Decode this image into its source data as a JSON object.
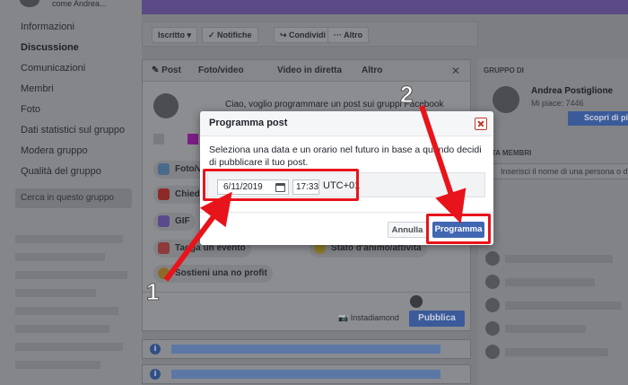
{
  "topbar": {
    "user_text": "come Andrea..."
  },
  "leftnav": {
    "items": [
      {
        "label": "Informazioni",
        "active": false
      },
      {
        "label": "Discussione",
        "active": true
      },
      {
        "label": "Comunicazioni",
        "active": false
      },
      {
        "label": "Membri",
        "active": false
      },
      {
        "label": "Foto",
        "active": false
      },
      {
        "label": "Dati statistici sul gruppo",
        "active": false
      },
      {
        "label": "Modera gruppo",
        "active": false
      },
      {
        "label": "Qualità del gruppo",
        "active": false
      }
    ],
    "search_placeholder": "Cerca in questo gruppo"
  },
  "actionbar": {
    "iscritto": "Iscritto ▾",
    "notifiche": "✓ Notifiche",
    "condividi": "↪ Condividi",
    "altro": "··· Altro"
  },
  "composer": {
    "tabs": [
      "✎ Post",
      "Foto/video",
      "Video in diretta",
      "Altro"
    ],
    "text": "Ciao, voglio programmare un post sui gruppi Facebook",
    "options": [
      "Foto/video",
      "Chiedi c...",
      "GIF",
      "Tagga un evento",
      "Stato d'animo/attività",
      "Sostieni una no profit"
    ],
    "instadiamond": "📷 Instadiamond",
    "publish": "Pubblica"
  },
  "rightcol": {
    "group_label": "GRUPPO DI",
    "admin_name": "Andrea Postiglione",
    "admin_likes": "Mi piace: 7446",
    "admin_button": "Scopri di più",
    "members_label": "...ITA MEMBRI",
    "members_placeholder": "Inserisci il nome di una persona o di un"
  },
  "dialog": {
    "title": "Programma post",
    "body": "Seleziona una data e un orario nel futuro in base a quando decidi di pubblicare il tuo post.",
    "date": "6/11/2019",
    "time": "17:33",
    "timezone": "UTC+01",
    "cancel": "Annulla",
    "confirm": "Programma"
  },
  "annotations": {
    "step1": "1",
    "step2": "2"
  },
  "colors": {
    "highlight": "#e8141b",
    "fb_blue": "#4267b2"
  }
}
